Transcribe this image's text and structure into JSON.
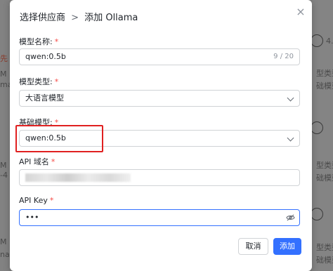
{
  "background": {
    "left_texts": [
      "先",
      "M",
      "ma",
      "M",
      "-4",
      "M",
      "na"
    ],
    "right_texts": [
      "4.",
      "型类型",
      "础模型",
      "型类型",
      "础模型",
      "型类型",
      "础模型",
      "型类型"
    ]
  },
  "modal": {
    "breadcrumb_parent": "选择供应商",
    "breadcrumb_sep": ">",
    "breadcrumb_current": "添加 Ollama",
    "close_glyph": "×"
  },
  "form": {
    "model_name": {
      "label": "模型名称:",
      "required": "*",
      "value": "qwen:0.5b",
      "counter": "9 / 20"
    },
    "model_type": {
      "label": "模型类型:",
      "required": "*",
      "value": "大语言模型"
    },
    "base_model": {
      "label": "基础模型:",
      "required": "*",
      "value": "qwen:0.5b"
    },
    "api_domain": {
      "label": "API 域名",
      "required": "*"
    },
    "api_key": {
      "label": "API Key",
      "required": "*",
      "value": "•••"
    }
  },
  "footer": {
    "cancel_label": "取消",
    "add_label": "添加"
  },
  "colors": {
    "primary": "#3370ff",
    "required": "#f54a45",
    "highlight": "#e02020"
  }
}
